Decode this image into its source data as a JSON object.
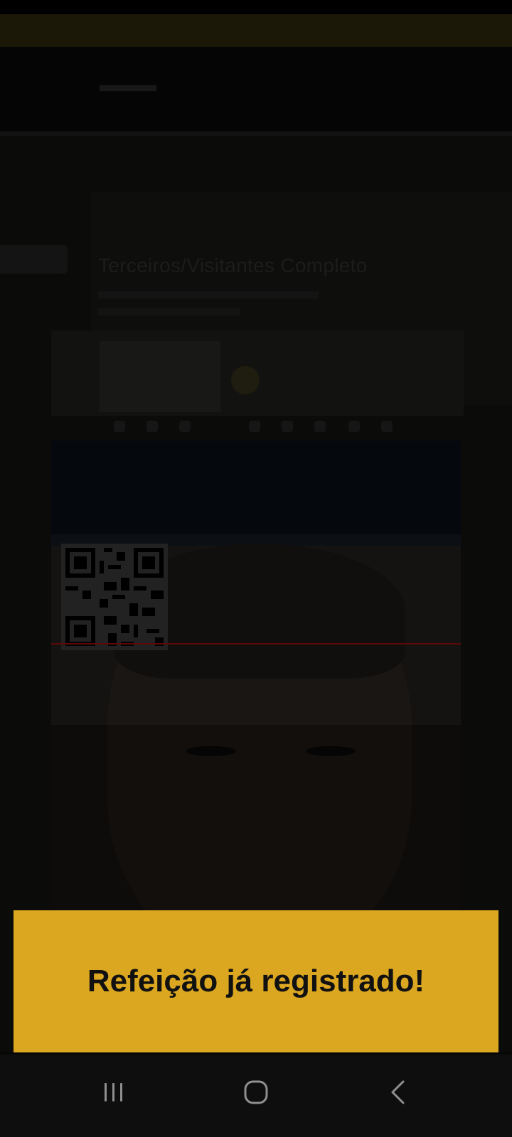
{
  "alert": {
    "message": "Refeição já registrado!",
    "background_color": "#dba721",
    "text_color": "#111111"
  },
  "background_feed": {
    "ghost_title": "Terceiros/Visitantes Completo"
  },
  "navigation_bar": {
    "recent_apps_icon": "recent-apps-icon",
    "home_icon": "home-icon",
    "back_icon": "back-icon"
  },
  "colors": {
    "scan_line": "#5a0808",
    "nav_background": "#0e0e0e"
  }
}
